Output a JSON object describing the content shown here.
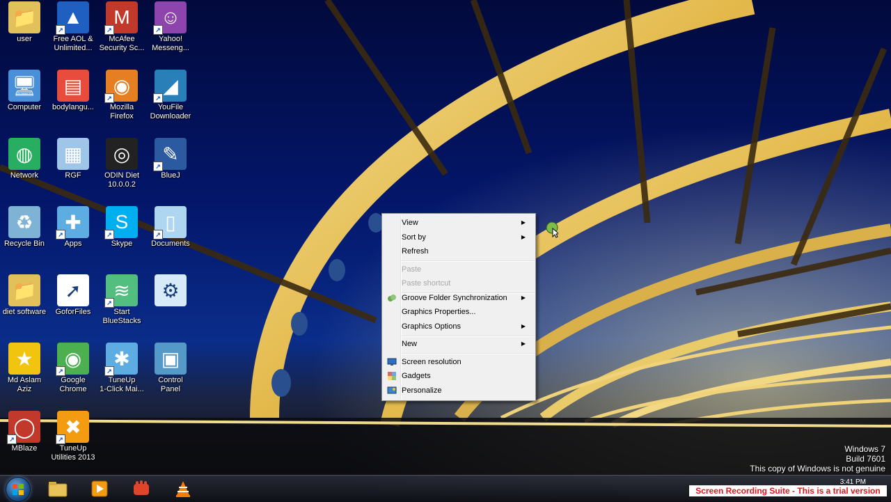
{
  "desktop": {
    "icons": [
      {
        "label": "user",
        "icon": "user-folder-icon"
      },
      {
        "label": "Free AOL &\nUnlimited...",
        "icon": "aol-icon"
      },
      {
        "label": "McAfee\nSecurity Sc...",
        "icon": "mcafee-icon"
      },
      {
        "label": "Yahoo!\nMesseng...",
        "icon": "yahoo-messenger-icon"
      },
      {
        "label": "Computer",
        "icon": "computer-icon"
      },
      {
        "label": "bodylangu...",
        "icon": "document-icon"
      },
      {
        "label": "Mozilla\nFirefox",
        "icon": "firefox-icon"
      },
      {
        "label": "YouFile\nDownloader",
        "icon": "youfile-icon"
      },
      {
        "label": "Network",
        "icon": "network-icon"
      },
      {
        "label": "RGF",
        "icon": "spreadsheet-icon"
      },
      {
        "label": "ODIN Diet\n10.0.0.2",
        "icon": "odin-icon"
      },
      {
        "label": "BlueJ",
        "icon": "bluej-icon"
      },
      {
        "label": "Recycle Bin",
        "icon": "recycle-bin-icon"
      },
      {
        "label": "Apps",
        "icon": "apps-icon"
      },
      {
        "label": "Skype",
        "icon": "skype-icon"
      },
      {
        "label": "Documents",
        "icon": "documents-icon"
      },
      {
        "label": "diet software",
        "icon": "folder-icon"
      },
      {
        "label": "GoforFiles",
        "icon": "goforfiles-icon"
      },
      {
        "label": "Start\nBlueStacks",
        "icon": "bluestacks-icon"
      },
      {
        "label": "",
        "icon": "settings-icon"
      },
      {
        "label": "Md Aslam\nAziz",
        "icon": "star-icon"
      },
      {
        "label": "Google\nChrome",
        "icon": "chrome-icon"
      },
      {
        "label": "TuneUp\n1-Click Mai...",
        "icon": "tuneup-maintenance-icon"
      },
      {
        "label": "Control\nPanel",
        "icon": "control-panel-icon"
      },
      {
        "label": "MBlaze",
        "icon": "mblaze-icon"
      },
      {
        "label": "TuneUp\nUtilities 2013",
        "icon": "tuneup-utilities-icon"
      }
    ]
  },
  "context_menu": {
    "items": [
      {
        "label": "View",
        "submenu": true,
        "disabled": false
      },
      {
        "label": "Sort by",
        "submenu": true,
        "disabled": false
      },
      {
        "label": "Refresh",
        "submenu": false,
        "disabled": false
      },
      {
        "label": "Paste",
        "submenu": false,
        "disabled": true
      },
      {
        "label": "Paste shortcut",
        "submenu": false,
        "disabled": true
      },
      {
        "label": "Groove Folder Synchronization",
        "submenu": true,
        "disabled": false,
        "icon": "groove-icon"
      },
      {
        "label": "Graphics Properties...",
        "submenu": false,
        "disabled": false
      },
      {
        "label": "Graphics Options",
        "submenu": true,
        "disabled": false
      },
      {
        "label": "New",
        "submenu": true,
        "disabled": false
      },
      {
        "label": "Screen resolution",
        "submenu": false,
        "disabled": false,
        "icon": "screen-resolution-icon"
      },
      {
        "label": "Gadgets",
        "submenu": false,
        "disabled": false,
        "icon": "gadgets-icon"
      },
      {
        "label": "Personalize",
        "submenu": false,
        "disabled": false,
        "icon": "personalize-icon"
      }
    ]
  },
  "watermark": {
    "line1": "Windows 7",
    "line2": "Build 7601",
    "line3": "This copy of Windows is not genuine"
  },
  "trial_banner": "Screen Recording Suite - This is a trial version",
  "taskbar": {
    "buttons": [
      "start-orb",
      "explorer-icon",
      "media-player-icon",
      "hand-app-icon",
      "vlc-icon"
    ],
    "clock": "3:41 PM"
  }
}
